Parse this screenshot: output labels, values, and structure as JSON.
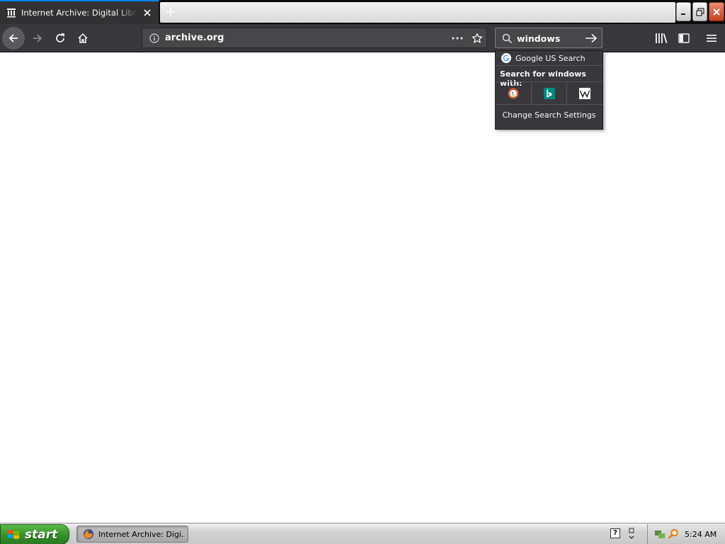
{
  "browser": {
    "tab": {
      "title": "Internet Archive: Digital Library of",
      "favicon": "archive-building-icon"
    },
    "url": "archive.org",
    "search": {
      "value": "windows"
    }
  },
  "search_dropdown": {
    "default_engine": "Google US Search",
    "search_for_label": "Search for windows with:",
    "engines": [
      "duckduckgo-icon",
      "bing-icon",
      "wikipedia-icon"
    ],
    "settings_label": "Change Search Settings"
  },
  "taskbar": {
    "start_label": "start",
    "task_label": "Internet Archive: Digi...",
    "help_label": "?",
    "clock": "5:24 AM"
  },
  "colors": {
    "tab_accent": "#0a84ff",
    "toolbar_bg": "#38383d",
    "start_green": "#35902a"
  }
}
